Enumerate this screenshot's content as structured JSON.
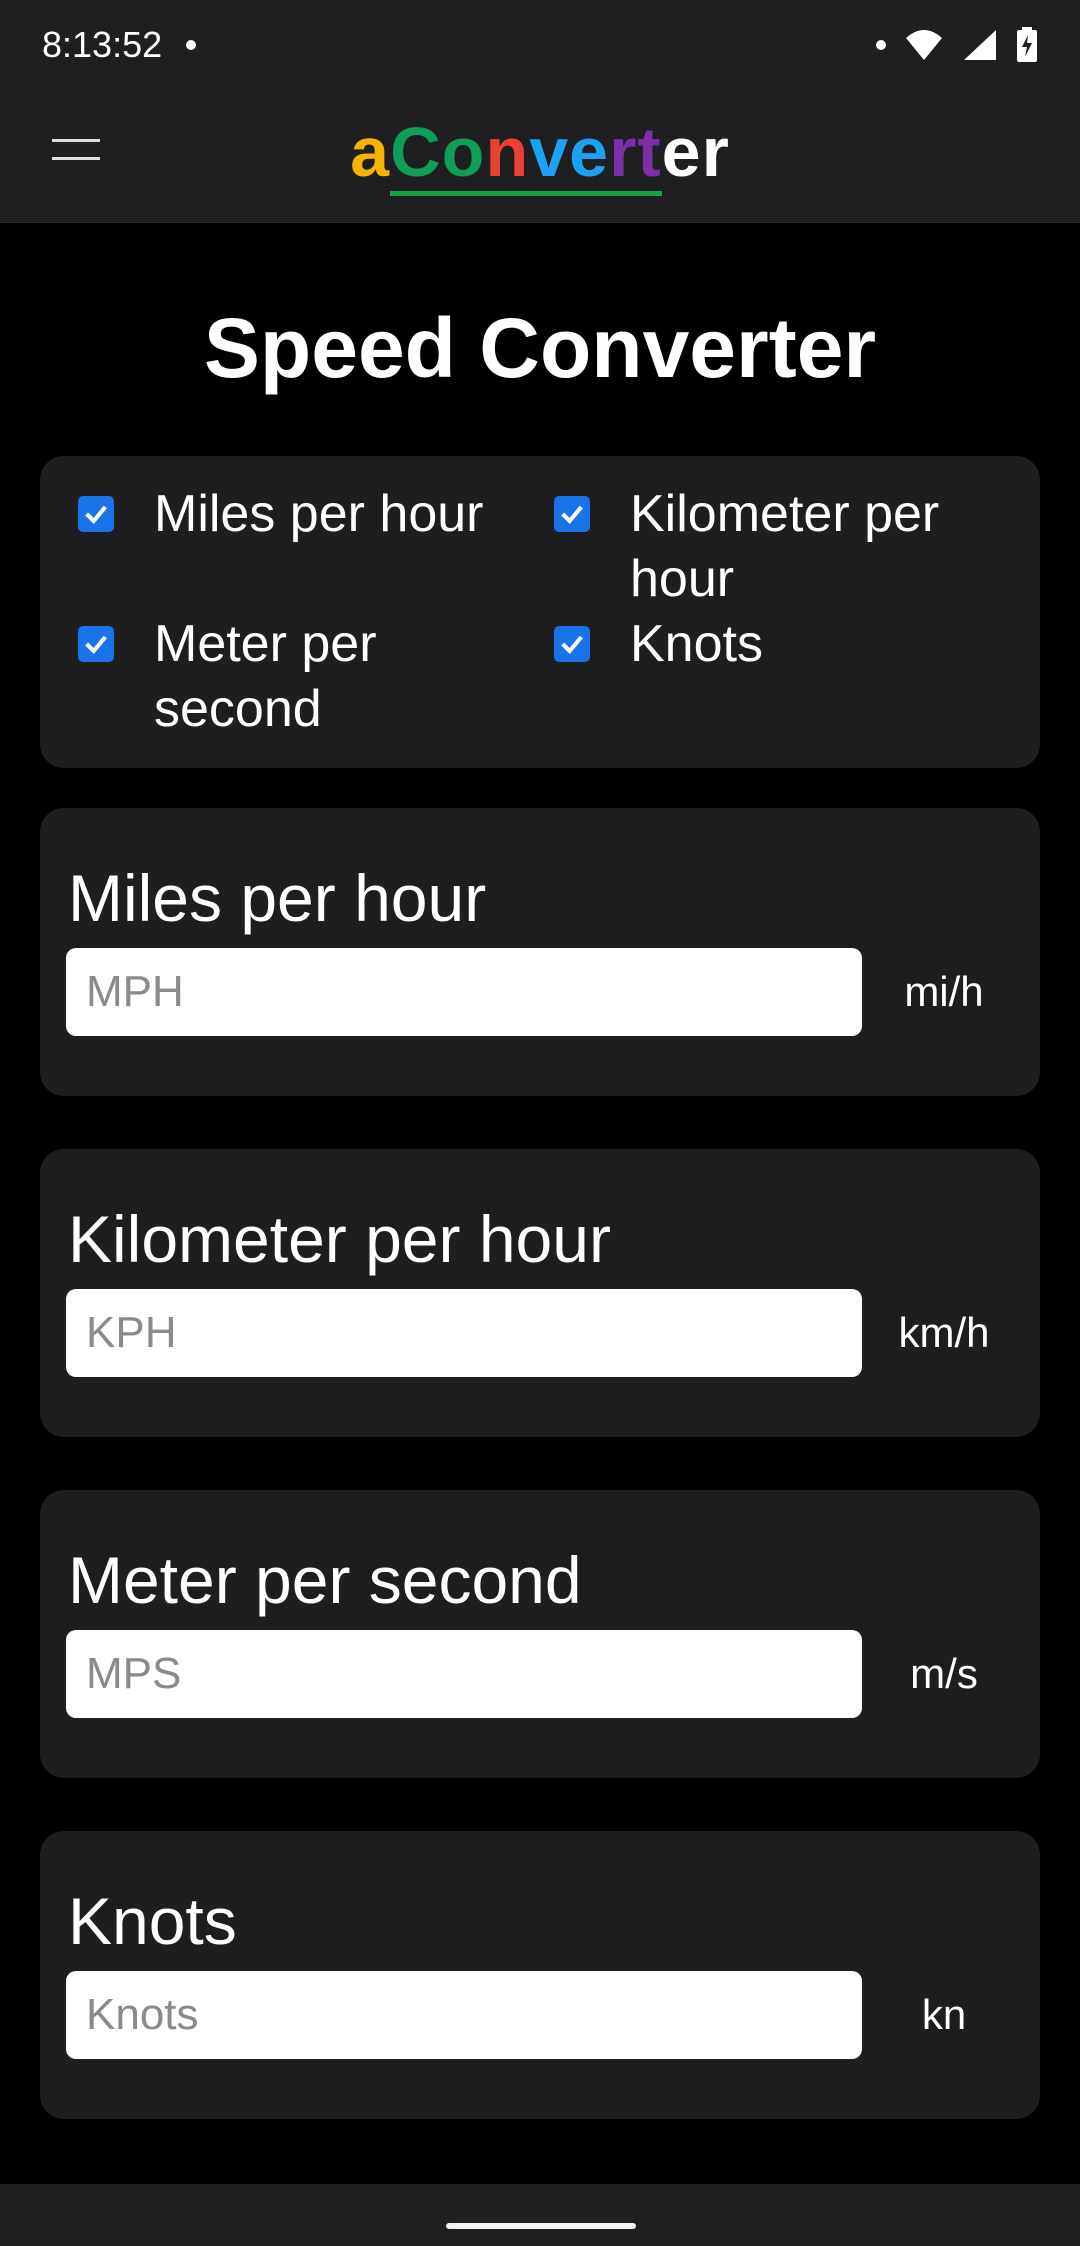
{
  "status": {
    "time": "8:13:52"
  },
  "app": {
    "logo": [
      {
        "ch": "a",
        "color": "#f4b400"
      },
      {
        "ch": "C",
        "color": "#0f9d58"
      },
      {
        "ch": "o",
        "color": "#0f9d58"
      },
      {
        "ch": "n",
        "color": "#e94235"
      },
      {
        "ch": "v",
        "color": "#1da1f2"
      },
      {
        "ch": "e",
        "color": "#1da1f2"
      },
      {
        "ch": "r",
        "color": "#7b2fa8"
      },
      {
        "ch": "t",
        "color": "#7b2fa8"
      },
      {
        "ch": "e",
        "color": "#ffffff"
      },
      {
        "ch": "r",
        "color": "#ffffff"
      }
    ]
  },
  "page": {
    "title": "Speed Converter"
  },
  "checkboxes": [
    {
      "label": "Miles per hour",
      "checked": true
    },
    {
      "label": "Kilometer per hour",
      "checked": true
    },
    {
      "label": "Meter per second",
      "checked": true
    },
    {
      "label": "Knots",
      "checked": true
    }
  ],
  "converters": [
    {
      "label": "Miles per hour",
      "placeholder": "MPH",
      "value": "",
      "unit": "mi/h"
    },
    {
      "label": "Kilometer per hour",
      "placeholder": "KPH",
      "value": "",
      "unit": "km/h"
    },
    {
      "label": "Meter per second",
      "placeholder": "MPS",
      "value": "",
      "unit": "m/s"
    },
    {
      "label": "Knots",
      "placeholder": "Knots",
      "value": "",
      "unit": "kn"
    }
  ],
  "colors": {
    "accent": "#1a73e8",
    "card": "#1e1e20",
    "bar": "#1f1f21"
  }
}
